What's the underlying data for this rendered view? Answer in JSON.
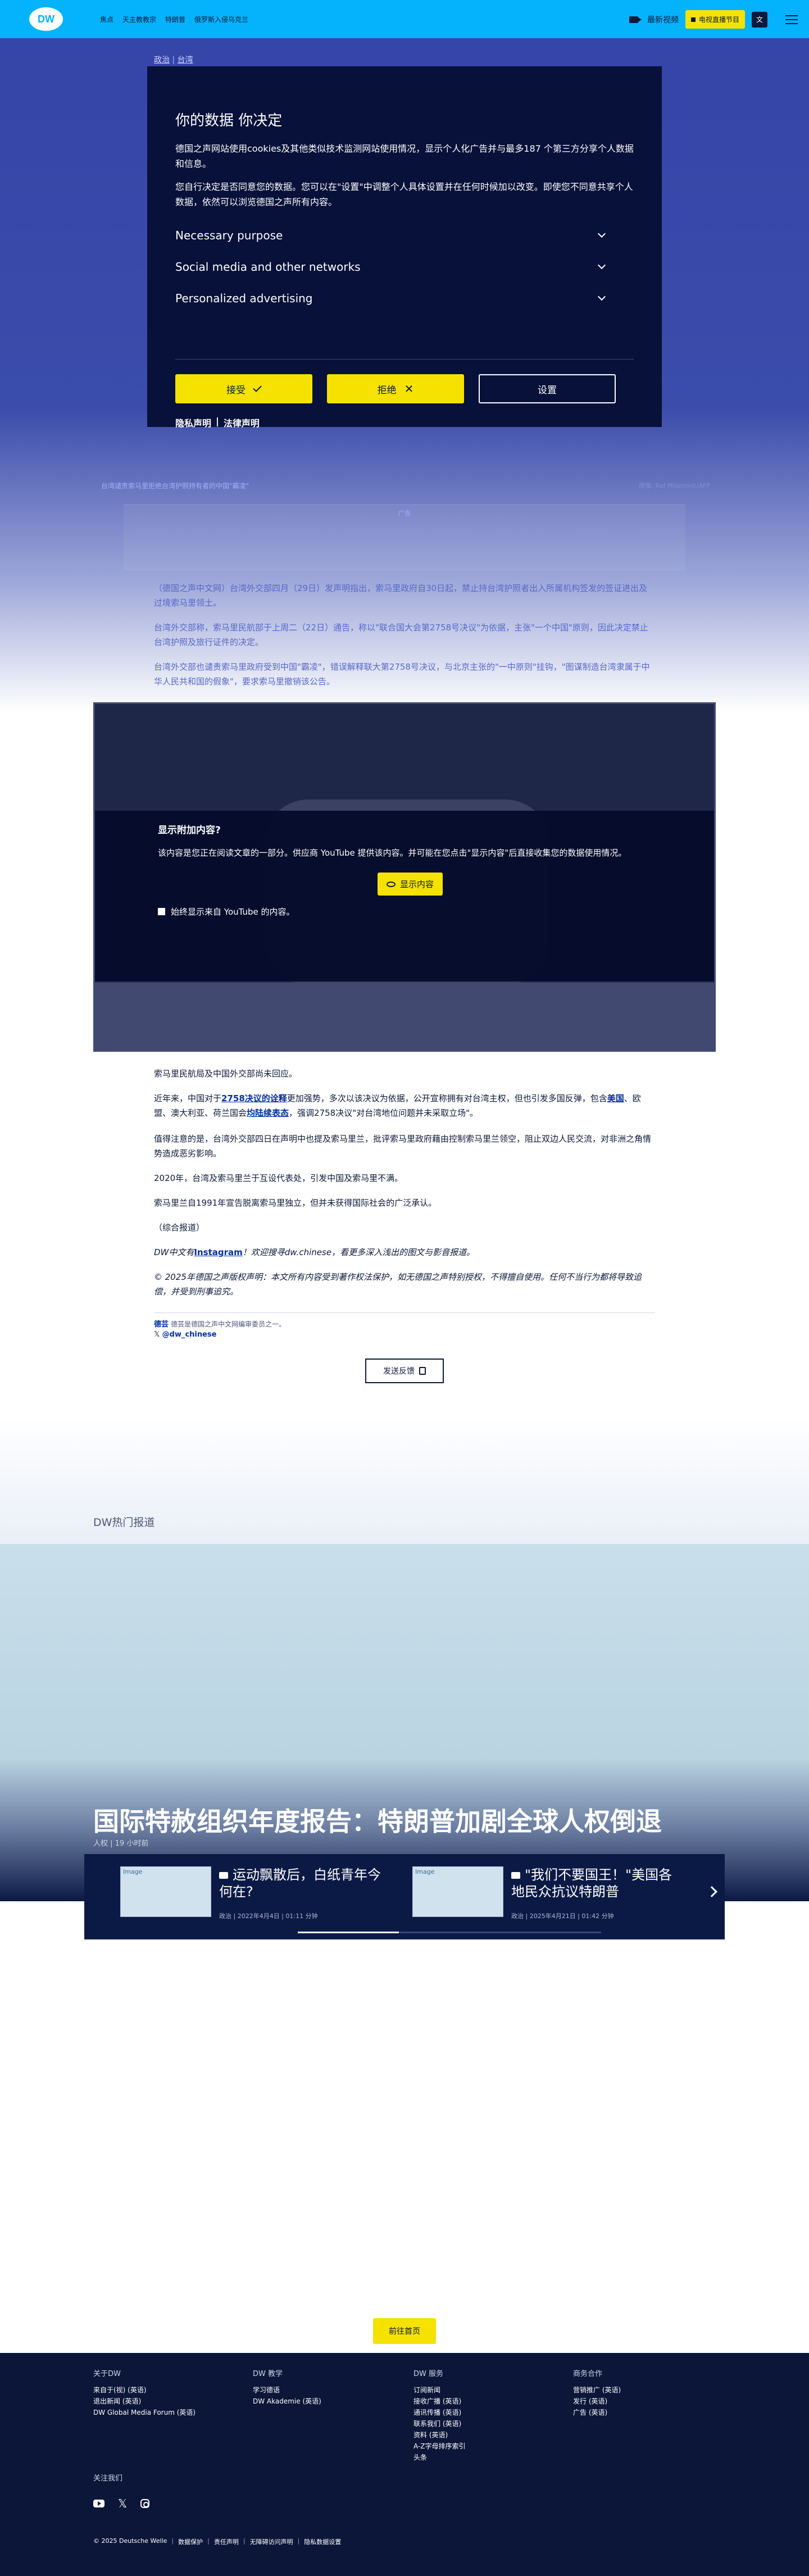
{
  "header": {
    "logo": "DW",
    "nav": [
      "焦点",
      "天主教教宗",
      "特朗普",
      "俄罗斯入侵乌克兰"
    ],
    "latest_video": "最新视频",
    "tv_schedule": "电视直播节目",
    "lang": "文"
  },
  "article": {
    "breadcrumb_a": "政治",
    "breadcrumb_b": "台湾",
    "caption": "台湾谴责索马里拒绝台湾护照持有者的中国\"霸凌\"",
    "credit": "图像: Raf Milanovic/AFP",
    "ad_label": "广告",
    "p1": "（德国之声中文网）台湾外交部四月（29日）发声明指出，索马里政府自30日起，禁止持台湾护照者出入所属机构签发的签证进出及过境索马里领土。",
    "p2": "台湾外交部称，索马里民航部于上周二（22日）通告，称以\"联合国大会第2758号决议\"为依据，主张\"一个中国\"原则，因此决定禁止台湾护照及旅行证件的决定。",
    "p3": "台湾外交部也谴责索马里政府受到中国\"霸凌\"，错误解释联大第2758号决议，与北京主张的\"一中原则\"挂钩，\"图谋制造台湾隶属于中华人民共和国的假象\"，要求索马里撤销该公告。",
    "after": {
      "p4": "索马里民航局及中国外交部尚未回应。",
      "p5_a": "近年来，中国对于",
      "p5_link1": "2758决议的诠释",
      "p5_b": "更加强势，多次以该决议为依据，公开宣称拥有对台湾主权，但也引发多国反弹，包含",
      "p5_link2": "美国",
      "p5_c": "、欧盟、澳大利亚、荷兰国会",
      "p5_link3": "均陆续表态",
      "p5_d": "，强调2758决议\"对台湾地位问题并未采取立场\"。",
      "p6": "值得注意的是，台湾外交部四日在声明中也提及索马里兰，批评索马里政府藉由控制索马里兰领空，阻止双边人民交流，对非洲之角情势造成恶劣影响。",
      "p7": "2020年，台湾及索马里兰于互设代表处，引发中国及索马里不满。",
      "p8": "索马里兰自1991年宣告脱离索马里独立，但并未获得国际社会的广泛承认。",
      "p9": "（综合报道）",
      "p10_a": "DW中文有",
      "p10_link": "Instagram",
      "p10_b": "！欢迎搜寻dw.chinese，看更多深入浅出的图文与影音报道。",
      "p11": "© 2025年德国之声版权声明：本文所有内容受到著作权法保护，如无德国之声特别授权，不得擅自使用。任何不当行为都将导致追偿，并受到刑事追究。",
      "follow_name": "德芸",
      "follow_desc": "德芸是德国之声中文网编审委员之一。",
      "follow_handle": "@dw_chinese",
      "feedback": "发送反馈"
    }
  },
  "consent": {
    "title": "你的数据 你决定",
    "p1": "德国之声网站使用cookies及其他类似技术监测网站使用情况，显示个人化广告并与最多187 个第三方分享个人数据和信息。",
    "p2": "您自行决定是否同意您的数据。您可以在\"设置\"中调整个人具体设置并在任何时候加以改变。即使您不同意共享个人数据，依然可以浏览德国之声所有内容。",
    "items": [
      "Necessary purpose",
      "Social media and other networks",
      "Personalized advertising"
    ],
    "accept": "接受",
    "reject": "拒绝",
    "settings": "设置",
    "privacy": "隐私声明",
    "legal": "法律声明"
  },
  "youtube": {
    "title": "显示附加内容?",
    "body": "该内容是您正在阅读文章的一部分。供应商 YouTube 提供该内容。并可能在您点击\"显示内容\"后直接收集您的数据使用情况。",
    "show": "显示内容",
    "always": "始终显示来自 YouTube 的内容。"
  },
  "hot": {
    "title": "DW热门报道",
    "hero_title": "国际特赦组织年度报告：特朗普加剧全球人权倒退",
    "hero_meta": "人权 | 19 小时前",
    "cards": [
      {
        "thumb": "Image",
        "title": "运动飘散后，白纸青年今何在?",
        "meta": "政治 | 2022年4月4日 | 01:11 分钟"
      },
      {
        "thumb": "Image",
        "title": "\"我们不要国王！\"美国各地民众抗议特朗普",
        "meta": "政治 | 2025年4月21日 | 01:42 分钟"
      }
    ],
    "go_home": "前往首页"
  },
  "footer": {
    "cols": [
      {
        "title": "关于DW",
        "items": [
          "来自于(视) (英语)",
          "退出新闻 (英语)",
          "DW Global Media Forum (英语)"
        ]
      },
      {
        "title": "DW 教学",
        "items": [
          "学习德语",
          "DW Akademie (英语)"
        ]
      },
      {
        "title": "DW 服务",
        "items": [
          "订阅新闻",
          "接收广播 (英语)",
          "通讯传播 (英语)",
          "联系我们 (英语)",
          "资料 (英语)",
          "A-Z字母排序索引",
          "头条"
        ]
      },
      {
        "title": "商务合作",
        "items": [
          "营销推广 (英语)",
          "发行 (英语)",
          "广告 (英语)"
        ]
      }
    ],
    "follow": "关注我们",
    "bottom": [
      "© 2025 Deutsche Welle",
      "数据保护",
      "责任声明",
      "无障碍访问声明",
      "隐私数据设置"
    ]
  }
}
